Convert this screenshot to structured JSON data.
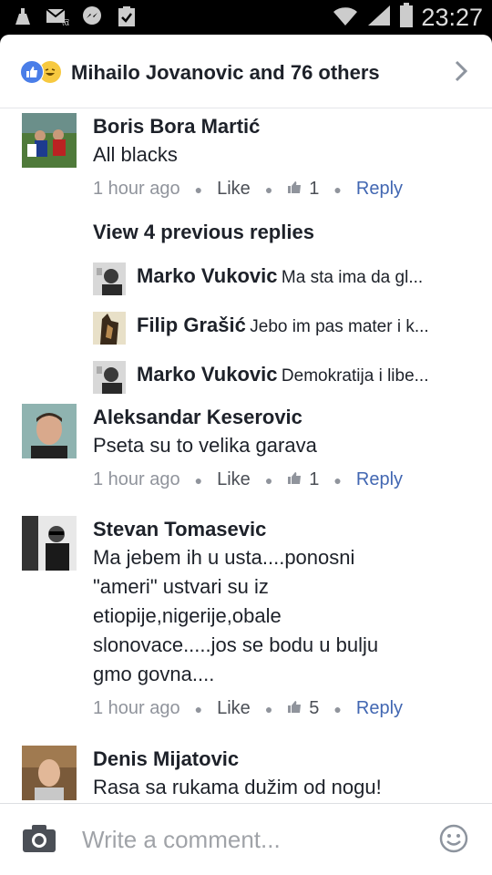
{
  "status_bar": {
    "time": "23:27"
  },
  "reactions": {
    "summary": "Mihailo Jovanovic and 76 others"
  },
  "comments": [
    {
      "name": "Boris Bora Martić",
      "text": "All blacks",
      "time": "1 hour ago",
      "like": "Like",
      "likes": "1",
      "reply": "Reply"
    },
    {
      "name": "Aleksandar Keserovic",
      "text": "Pseta su to velika garava",
      "time": "1 hour ago",
      "like": "Like",
      "likes": "1",
      "reply": "Reply"
    },
    {
      "name": "Stevan Tomasevic",
      "text_lines": [
        "Ma jebem ih u usta....ponosni",
        "\"ameri\" ustvari su iz",
        "etiopije,nigerije,obale",
        "slonovace.....jos se bodu u bulju",
        "gmo govna...."
      ],
      "time": "1 hour ago",
      "like": "Like",
      "likes": "5",
      "reply": "Reply"
    },
    {
      "name": "Denis Mijatovic",
      "text": "Rasa sa rukama dužim od nogu!"
    }
  ],
  "previous_replies": {
    "label": "View 4 previous replies",
    "items": [
      {
        "name": "Marko Vukovic",
        "text": "Ma sta ima da gl..."
      },
      {
        "name": "Filip Grašić",
        "text": "Jebo im pas mater i k..."
      },
      {
        "name": "Marko Vukovic",
        "text": "Demokratija i libe..."
      }
    ]
  },
  "composer": {
    "placeholder": "Write a comment..."
  },
  "colors": {
    "accent": "#4267b2",
    "text": "#1d2129",
    "meta": "#90949c"
  }
}
